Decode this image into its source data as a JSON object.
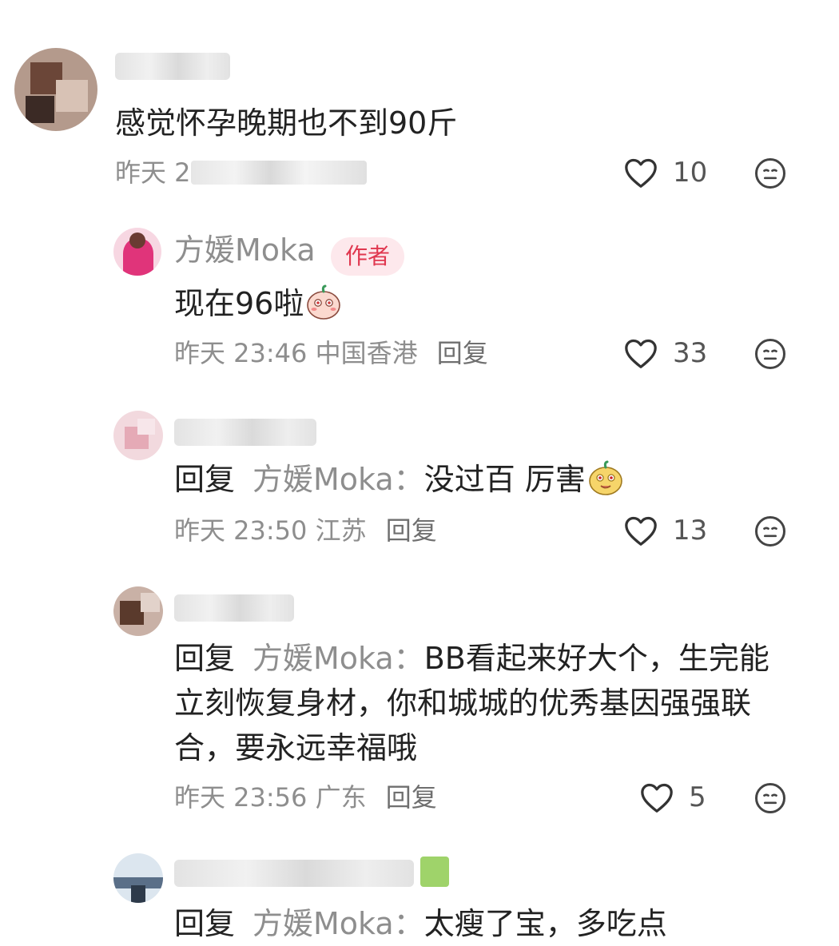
{
  "comments": [
    {
      "body": "感觉怀孕晚期也不到90斤",
      "meta_prefix": "昨天 2",
      "likes": "10"
    },
    {
      "name": "方媛Moka",
      "badge": "作者",
      "body": "现在96啦",
      "emoji": "blushing-face-emoji",
      "time": "昨天 23:46",
      "location": "中国香港",
      "reply_label": "回复",
      "likes": "33"
    },
    {
      "reply_word": "回复",
      "reply_to": "方媛Moka：",
      "body": "没过百 厉害",
      "emoji": "yellow-face-emoji",
      "time": "昨天 23:50",
      "location": "江苏",
      "reply_label": "回复",
      "likes": "13"
    },
    {
      "reply_word": "回复",
      "reply_to": "方媛Moka：",
      "body": "BB看起来好大个，生完能立刻恢复身材，你和城城的优秀基因强强联合，要永远幸福哦",
      "time": "昨天 23:56",
      "location": "广东",
      "reply_label": "回复",
      "likes": "5"
    },
    {
      "reply_word": "回复",
      "reply_to": "方媛Moka：",
      "body": "太瘦了宝，多吃点"
    }
  ],
  "colors": {
    "secondary_text": "#8e8e8e",
    "author_badge_bg": "#fde8ec",
    "author_badge_text": "#e0374f"
  },
  "icons": [
    "heart-outline-icon",
    "emoji-reaction-icon"
  ]
}
